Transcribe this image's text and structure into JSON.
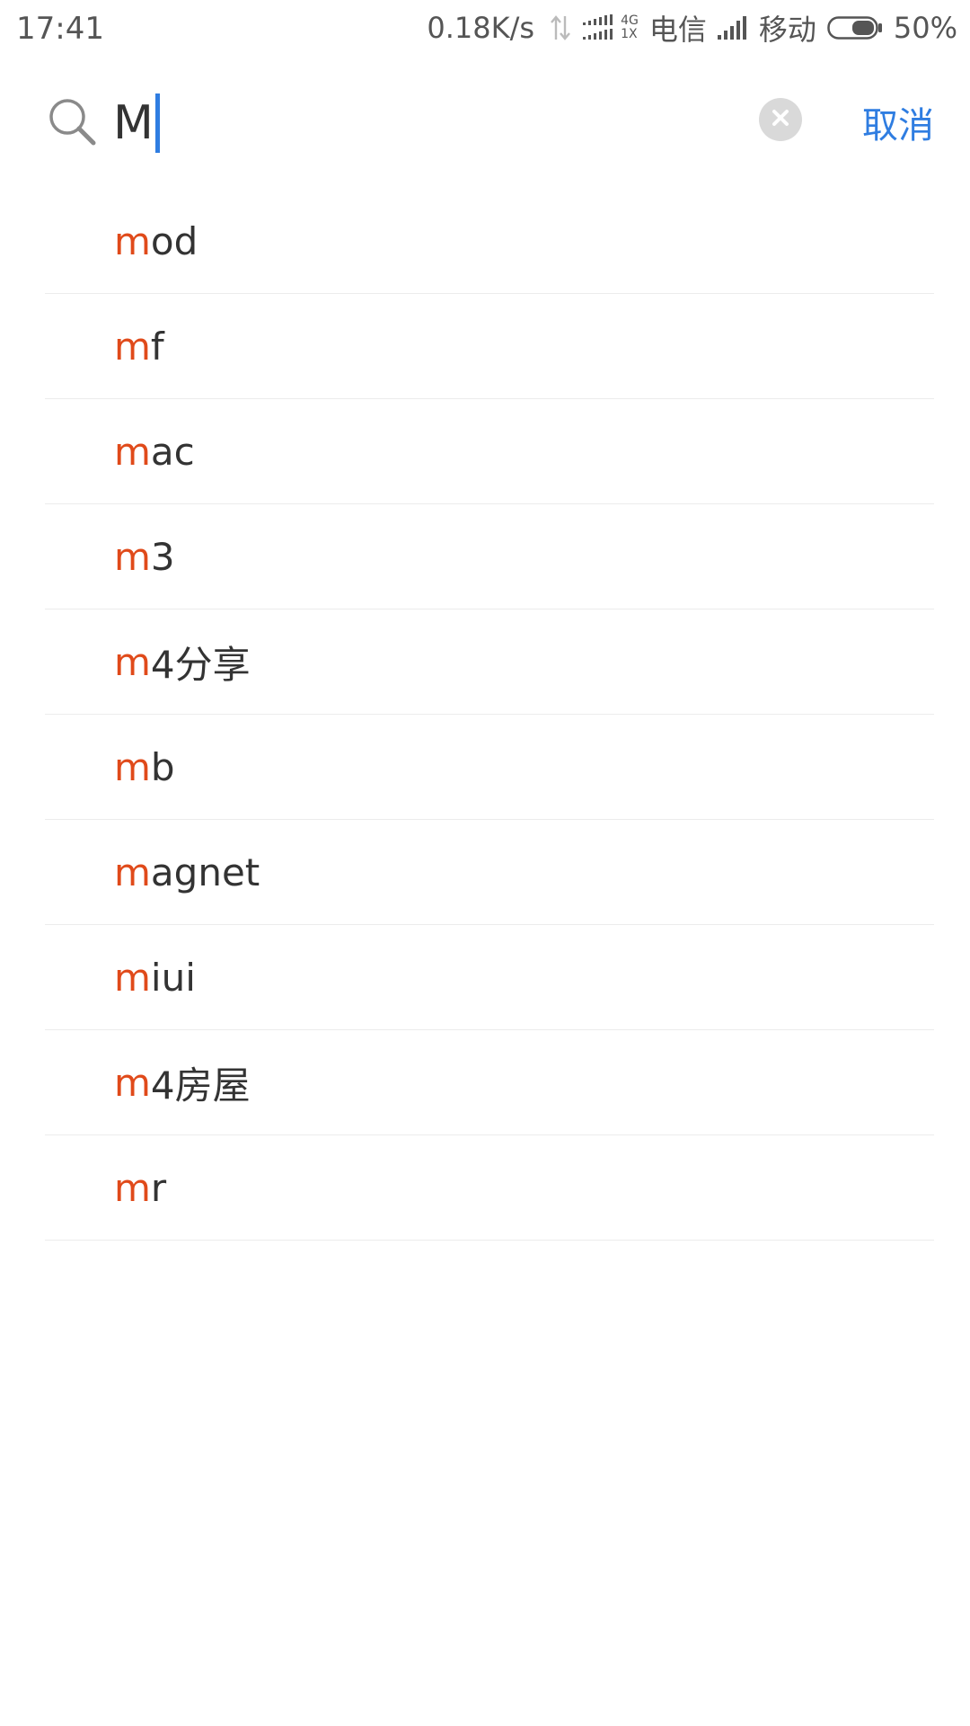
{
  "status_bar": {
    "time": "17:41",
    "net_speed": "0.18K/s",
    "net_type_top": "4G",
    "net_type_bottom": "1X",
    "carrier1": "电信",
    "carrier2": "移动",
    "battery": "50%"
  },
  "search": {
    "value": "M",
    "cancel_label": "取消"
  },
  "suggestions": [
    {
      "match": "m",
      "rest": "od"
    },
    {
      "match": "m",
      "rest": "f"
    },
    {
      "match": "m",
      "rest": "ac"
    },
    {
      "match": "m",
      "rest": "3"
    },
    {
      "match": "m",
      "rest": "4分享"
    },
    {
      "match": "m",
      "rest": "b"
    },
    {
      "match": "m",
      "rest": "agnet"
    },
    {
      "match": "m",
      "rest": "iui"
    },
    {
      "match": "m",
      "rest": "4房屋"
    },
    {
      "match": "m",
      "rest": "r"
    }
  ],
  "colors": {
    "accent": "#2f7de1",
    "highlight": "#e04a1a",
    "divider": "#ececec"
  }
}
